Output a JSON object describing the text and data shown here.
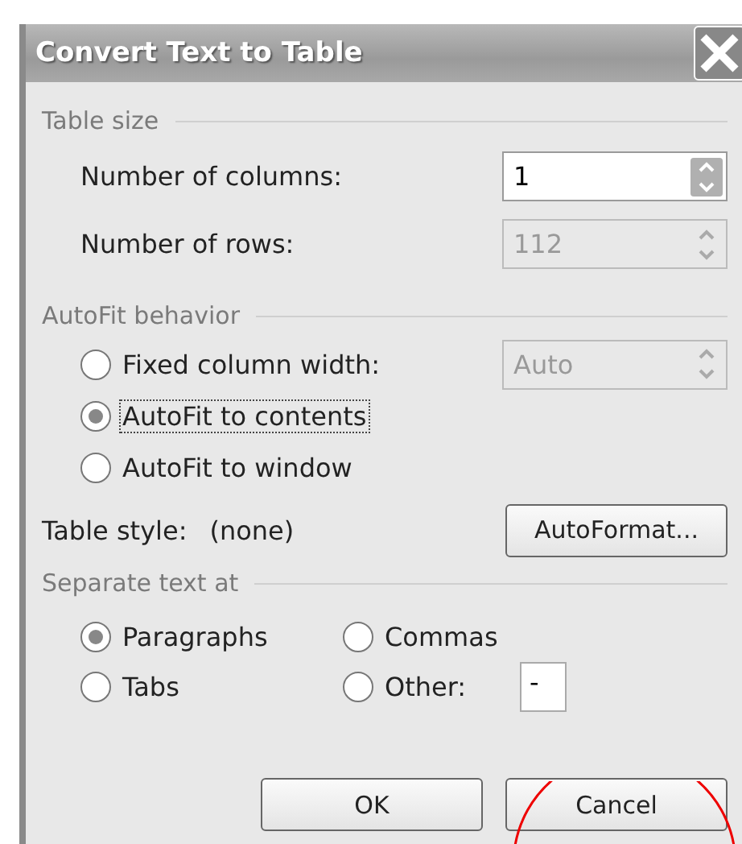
{
  "window": {
    "title": "Convert Text to Table"
  },
  "table_size": {
    "header": "Table size",
    "columns": {
      "label": "Number of columns:",
      "value": "1",
      "disabled": false
    },
    "rows": {
      "label": "Number of rows:",
      "value": "112",
      "disabled": true
    }
  },
  "autofit": {
    "header": "AutoFit behavior",
    "options": [
      {
        "label": "Fixed column width:",
        "selected": false,
        "focused": false
      },
      {
        "label": "AutoFit to contents",
        "selected": true,
        "focused": true
      },
      {
        "label": "AutoFit to window",
        "selected": false,
        "focused": false
      }
    ],
    "width_field": {
      "value": "Auto",
      "disabled": true
    }
  },
  "table_style": {
    "label": "Table style:",
    "value": "(none)",
    "button": "AutoFormat..."
  },
  "separate": {
    "header": "Separate text at",
    "options": [
      {
        "label": "Paragraphs",
        "selected": true
      },
      {
        "label": "Commas",
        "selected": false
      },
      {
        "label": "Tabs",
        "selected": false
      },
      {
        "label": "Other:",
        "selected": false
      }
    ],
    "other_field": {
      "value": "-"
    }
  },
  "buttons": [
    {
      "label": "OK"
    },
    {
      "label": "Cancel"
    }
  ]
}
